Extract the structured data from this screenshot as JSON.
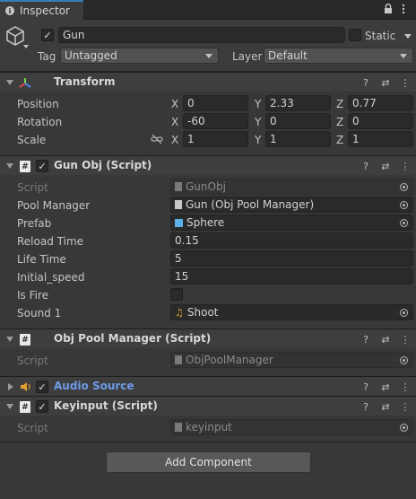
{
  "window": {
    "tab_label": "Inspector"
  },
  "object": {
    "name": "Gun",
    "static_label": "Static",
    "tag_label": "Tag",
    "tag_value": "Untagged",
    "layer_label": "Layer",
    "layer_value": "Default"
  },
  "transform": {
    "title": "Transform",
    "position_label": "Position",
    "rotation_label": "Rotation",
    "scale_label": "Scale",
    "axis_x": "X",
    "axis_y": "Y",
    "axis_z": "Z",
    "position": {
      "x": "0",
      "y": "2.33",
      "z": "0.77"
    },
    "rotation": {
      "x": "-60",
      "y": "0",
      "z": "0"
    },
    "scale": {
      "x": "1",
      "y": "1",
      "z": "1"
    }
  },
  "gun_obj": {
    "title": "Gun Obj (Script)",
    "script_label": "Script",
    "script_value": "GunObj",
    "pool_label": "Pool Manager",
    "pool_value": "Gun (Obj Pool Manager)",
    "prefab_label": "Prefab",
    "prefab_value": "Sphere",
    "reload_label": "Reload Time",
    "reload_value": "0.15",
    "life_label": "Life Time",
    "life_value": "5",
    "speed_label": "Initial_speed",
    "speed_value": "15",
    "isfire_label": "Is Fire",
    "sound_label": "Sound 1",
    "sound_value": "Shoot"
  },
  "pool_manager": {
    "title": "Obj Pool Manager (Script)",
    "script_label": "Script",
    "script_value": "ObjPoolManager"
  },
  "audio_source": {
    "title": "Audio Source"
  },
  "keyinput": {
    "title": "Keyinput (Script)",
    "script_label": "Script",
    "script_value": "keyinput"
  },
  "add_component_label": "Add Component",
  "colors": {
    "accent": "#3a79bb",
    "link_title": "#6e9ce8",
    "background": "#383838"
  }
}
